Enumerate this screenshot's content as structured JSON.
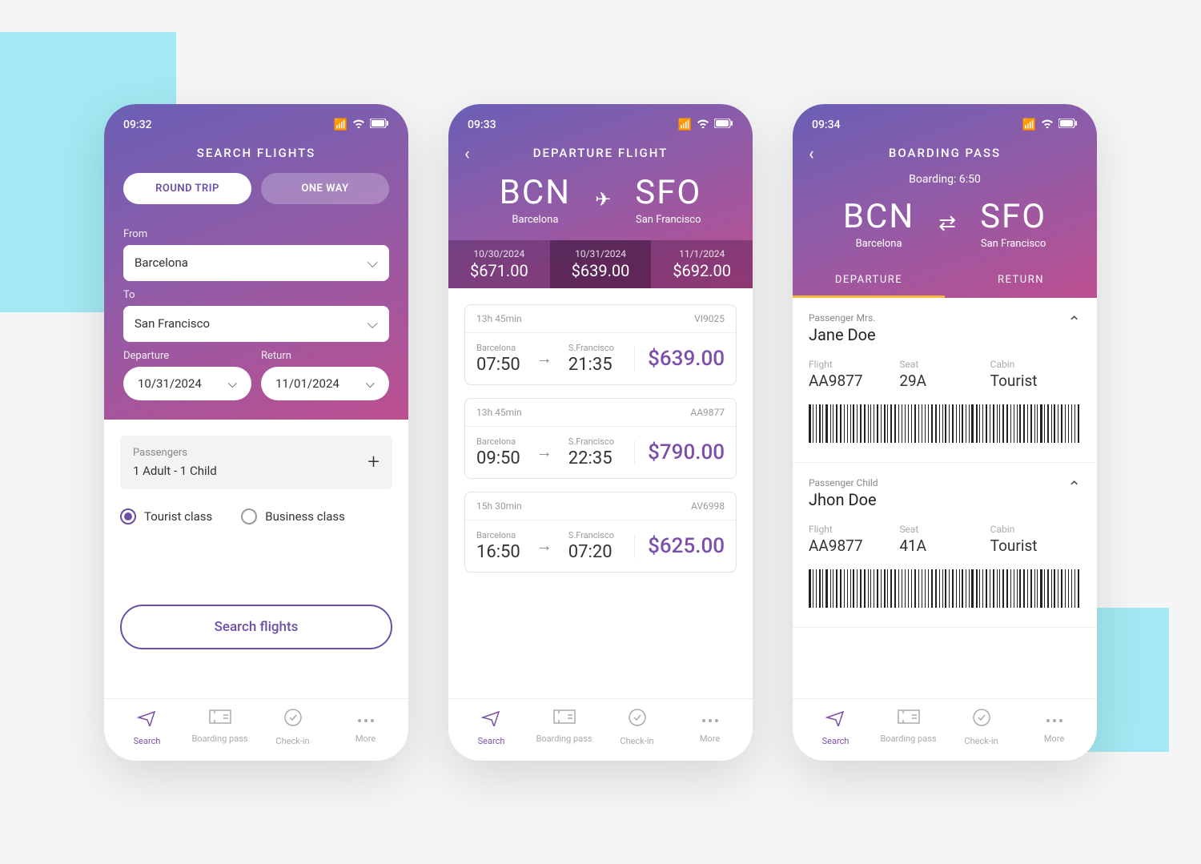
{
  "tabbar": {
    "items": [
      {
        "label": "Search",
        "active": true
      },
      {
        "label": "Boarding pass",
        "active": false
      },
      {
        "label": "Check-in",
        "active": false
      },
      {
        "label": "More",
        "active": false
      }
    ]
  },
  "screen1": {
    "time": "09:32",
    "title": "SEARCH FLIGHTS",
    "toggle": {
      "round": "ROUND TRIP",
      "oneway": "ONE WAY"
    },
    "from_label": "From",
    "from_value": "Barcelona",
    "to_label": "To",
    "to_value": "San Francisco",
    "dep_label": "Departure",
    "dep_value": "10/31/2024",
    "ret_label": "Return",
    "ret_value": "11/01/2024",
    "pax_label": "Passengers",
    "pax_value": "1 Adult   -  1 Child",
    "class_tourist": "Tourist class",
    "class_business": "Business class",
    "search_btn": "Search flights"
  },
  "screen2": {
    "time": "09:33",
    "title": "DEPARTURE FLIGHT",
    "from_code": "BCN",
    "from_name": "Barcelona",
    "to_code": "SFO",
    "to_name": "San Francisco",
    "dates": [
      {
        "date": "10/30/2024",
        "price": "$671.00"
      },
      {
        "date": "10/31/2024",
        "price": "$639.00",
        "active": true
      },
      {
        "date": "11/1/2024",
        "price": "$692.00"
      }
    ],
    "flights": [
      {
        "duration": "13h 45min",
        "flight_no": "VI9025",
        "dep_city": "Barcelona",
        "dep_time": "07:50",
        "arr_city": "S.Francisco",
        "arr_time": "21:35",
        "price": "$639.00"
      },
      {
        "duration": "13h 45min",
        "flight_no": "AA9877",
        "dep_city": "Barcelona",
        "dep_time": "09:50",
        "arr_city": "S.Francisco",
        "arr_time": "22:35",
        "price": "$790.00"
      },
      {
        "duration": "15h 30min",
        "flight_no": "AV6998",
        "dep_city": "Barcelona",
        "dep_time": "16:50",
        "arr_city": "S.Francisco",
        "arr_time": "07:20",
        "price": "$625.00"
      }
    ]
  },
  "screen3": {
    "time": "09:34",
    "title": "BOARDING PASS",
    "boarding": "Boarding: 6:50",
    "from_code": "BCN",
    "from_name": "Barcelona",
    "to_code": "SFO",
    "to_name": "San Francisco",
    "tabs": {
      "departure": "DEPARTURE",
      "return": "RETURN"
    },
    "passengers": [
      {
        "label": "Passenger Mrs.",
        "name": "Jane Doe",
        "flight": "AA9877",
        "seat": "29A",
        "cabin": "Tourist"
      },
      {
        "label": "Passenger Child",
        "name": "Jhon Doe",
        "flight": "AA9877",
        "seat": "41A",
        "cabin": "Tourist"
      }
    ],
    "labels": {
      "flight": "Flight",
      "seat": "Seat",
      "cabin": "Cabin"
    }
  }
}
